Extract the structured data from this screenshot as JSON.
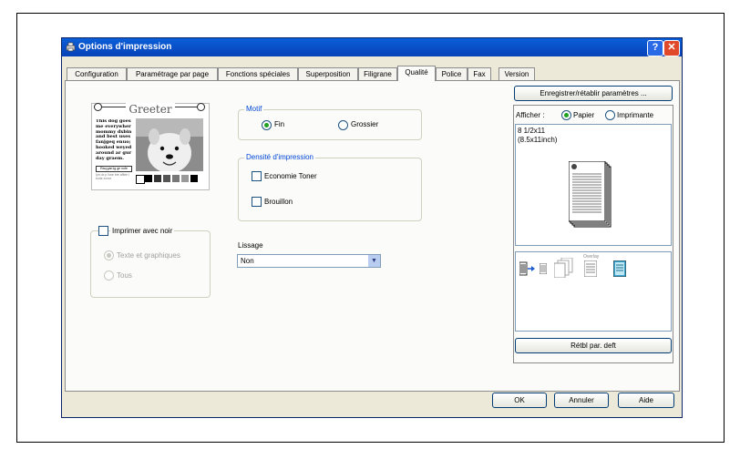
{
  "window": {
    "title": "Options d'impression",
    "help_label": "?",
    "close_label": "✕"
  },
  "tabs": [
    {
      "label": "Configuration"
    },
    {
      "label": "Paramétrage par page"
    },
    {
      "label": "Fonctions spéciales"
    },
    {
      "label": "Superposition"
    },
    {
      "label": "Filigrane"
    },
    {
      "label": "Qualité"
    },
    {
      "label": "Police"
    },
    {
      "label": "Fax"
    },
    {
      "label": "Version"
    }
  ],
  "active_tab": "Qualité",
  "preview_image": {
    "heading": "Greeter",
    "body_text": "This dog goes me everywher mommy dxbin and best uses fanjgeq enuo; hooked weyed around ar gur day graem.",
    "caption": "Raq gan1g ge nofe",
    "small_text": "Iyn dx p Isne bre afflen l kode xxxxx"
  },
  "motif": {
    "group_label": "Motif",
    "options": [
      {
        "label": "Fin",
        "selected": true
      },
      {
        "label": "Grossier",
        "selected": false
      }
    ]
  },
  "densite": {
    "group_label": "Densité d'impression",
    "economie": {
      "label": "Economie Toner",
      "checked": false
    },
    "brouillon": {
      "label": "Brouillon",
      "checked": false
    }
  },
  "noir": {
    "label": "Imprimer avec noir",
    "checked": false,
    "options": [
      {
        "label": "Texte et graphiques",
        "selected": true
      },
      {
        "label": "Tous",
        "selected": false
      }
    ]
  },
  "lissage": {
    "label": "Lissage",
    "value": "Non"
  },
  "right": {
    "save_button": "Enregistrer/rétablir paramètres ...",
    "afficher_label": "Afficher :",
    "papier_label": "Papier",
    "imprimante_label": "Imprimante",
    "view_selected": "Papier",
    "paper_size": "8 1/2x11",
    "paper_size_inch": "(8.5x11inch)",
    "overlay_label": "Overlay",
    "reset_button": "Rétbl par. deft"
  },
  "buttons": {
    "ok": "OK",
    "annuler": "Annuler",
    "aide": "Aide"
  },
  "colors": {
    "titlebar": "#0842b8",
    "accent_green": "#21a121",
    "group_label": "#0046d5",
    "window_bg": "#ece9d8"
  }
}
